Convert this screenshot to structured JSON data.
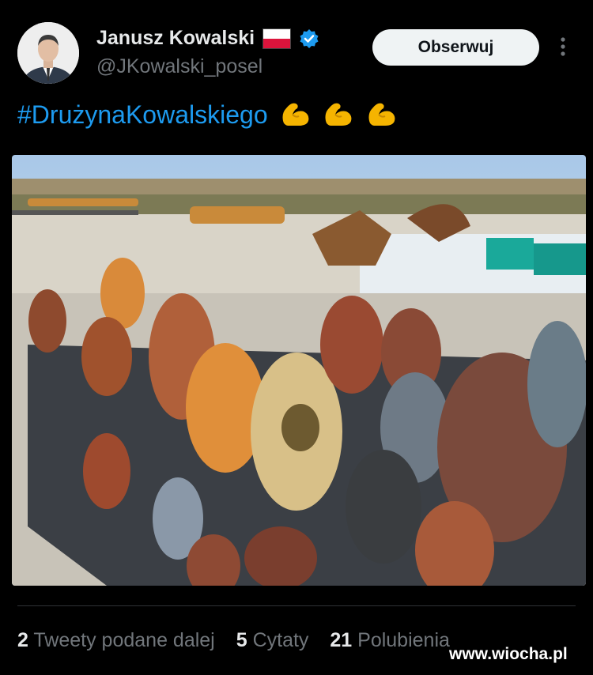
{
  "author": {
    "name": "Janusz Kowalski",
    "handle": "@JKowalski_posel",
    "flag_icon": "poland-flag-icon",
    "verified_icon": "verified-badge-icon",
    "verified_color": "#1d9bf0"
  },
  "follow_button": {
    "label": "Obserwuj"
  },
  "more_icon": "more-vertical-icon",
  "tweet": {
    "hashtag": "#DrużynaKowalskiego",
    "emojis": [
      "flexed-biceps-icon",
      "flexed-biceps-icon",
      "flexed-biceps-icon"
    ]
  },
  "photo": {
    "subject": "pottery-vases-photo"
  },
  "stats": {
    "retweets_count": "2",
    "retweets_label": "Tweety podane dalej",
    "quotes_count": "5",
    "quotes_label": "Cytaty",
    "likes_count": "21",
    "likes_label": "Polubienia"
  },
  "watermark": "www.wiocha.pl",
  "colors": {
    "accent": "#1d9bf0",
    "background": "#000000",
    "muted": "#71767b"
  }
}
